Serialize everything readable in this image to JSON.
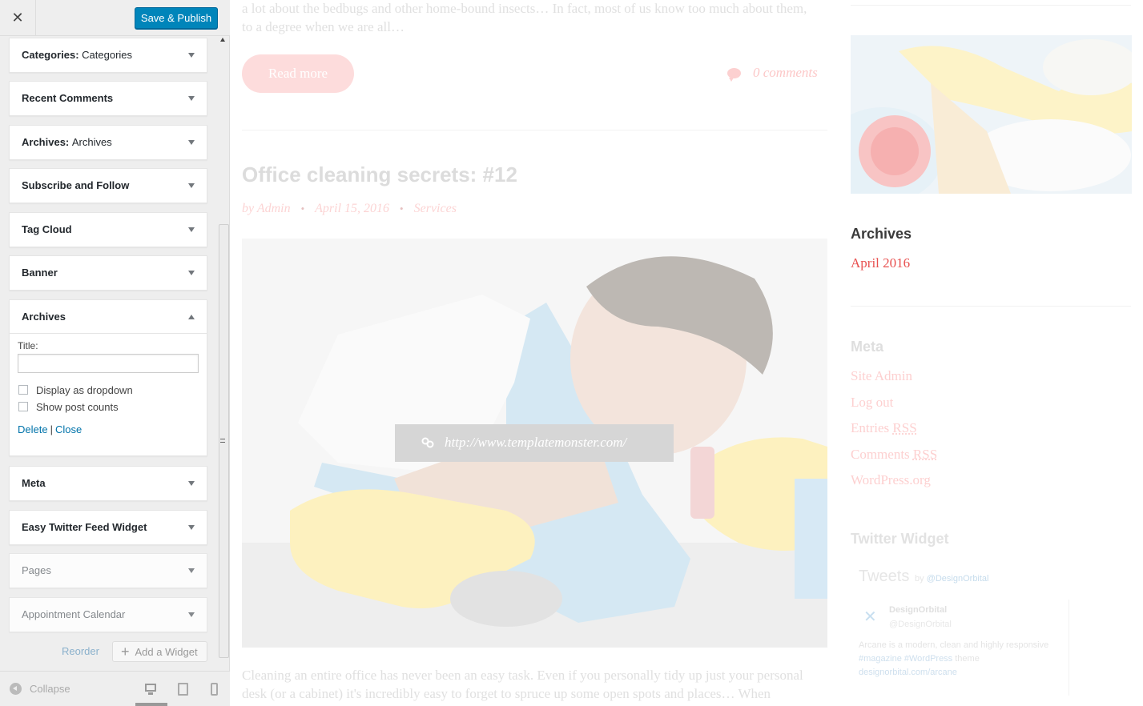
{
  "customizer": {
    "close_icon": "close-icon",
    "publish_label": "Save & Publish",
    "widgets": [
      {
        "title": "Categories",
        "subtitle": "Categories"
      },
      {
        "title": "Recent Comments",
        "subtitle": ""
      },
      {
        "title": "Archives",
        "subtitle": "Archives"
      },
      {
        "title": "Subscribe and Follow",
        "subtitle": ""
      },
      {
        "title": "Tag Cloud",
        "subtitle": ""
      },
      {
        "title": "Banner",
        "subtitle": ""
      },
      {
        "title": "Archives",
        "subtitle": ""
      },
      {
        "title": "Meta",
        "subtitle": ""
      },
      {
        "title": "Easy Twitter Feed Widget",
        "subtitle": ""
      },
      {
        "title": "Pages",
        "subtitle": ""
      },
      {
        "title": "Appointment Calendar",
        "subtitle": ""
      }
    ],
    "open_widget": {
      "title_label": "Title:",
      "title_value": "",
      "option_dropdown": "Display as dropdown",
      "option_counts": "Show post counts",
      "delete_label": "Delete",
      "separator": "|",
      "close_label": "Close"
    },
    "reorder_label": "Reorder",
    "add_widget_label": "Add a Widget",
    "collapse_label": "Collapse"
  },
  "preview": {
    "excerpt_top": "a lot about the bedbugs and other home-bound insects… In fact, most of us know too much about them, to a degree when we are all…",
    "read_more": "Read more",
    "comments": "0 comments",
    "post_title": "Office cleaning secrets: #12",
    "meta_author": "by Admin",
    "meta_date": "April 15, 2016",
    "meta_category": "Services",
    "meta_dot": "•",
    "image_url": "http://www.templatemonster.com/",
    "excerpt_bottom": "Cleaning an entire office has never been an easy task. Even if you personally tidy up just your personal desk (or a cabinet) it's incredibly easy to forget to spruce up some open spots and places… When"
  },
  "sidebar_right": {
    "archives_heading": "Archives",
    "archives_item": "April 2016",
    "meta_heading": "Meta",
    "meta_items": [
      "Site Admin",
      "Log out",
      "Entries",
      "Comments",
      "WordPress.org"
    ],
    "meta_rss": "RSS",
    "twitter_heading": "Twitter Widget",
    "tweets_title": "Tweets",
    "tweets_by": "by",
    "tweets_handle": "@DesignOrbital",
    "tweet_name": "DesignOrbital",
    "tweet_handle": "@DesignOrbital",
    "tweet_text": "Arcane is a modern, clean and highly responsive",
    "tweet_tags": "#magazine #WordPress",
    "tweet_text2": "theme",
    "tweet_link": "designorbital.com/arcane"
  },
  "colors": {
    "publish_bg": "#0085ba",
    "link": "#0073aa",
    "accent": "#e8504f"
  }
}
